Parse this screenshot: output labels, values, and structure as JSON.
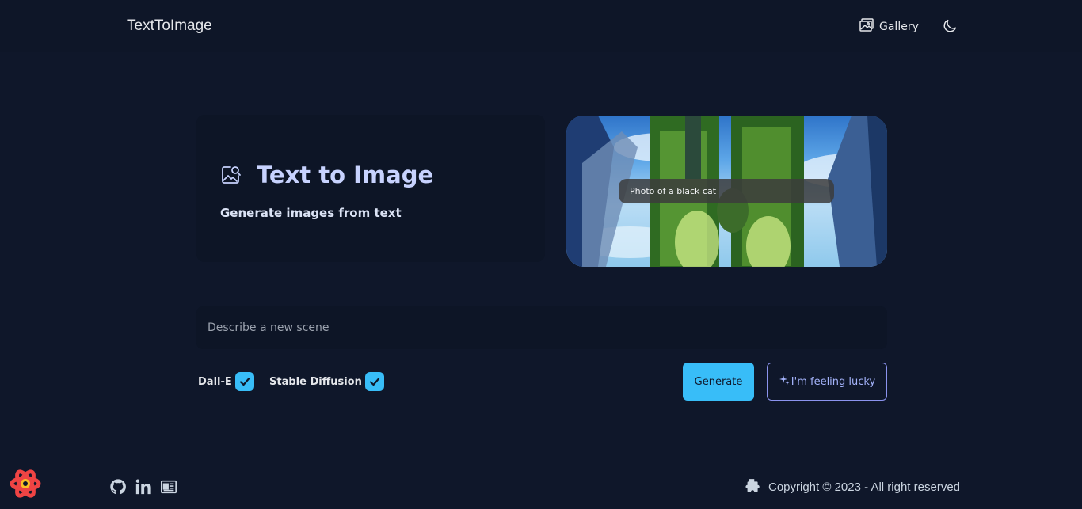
{
  "header": {
    "brand": "TextToImage",
    "gallery_label": "Gallery",
    "icons": [
      "gallery-icon",
      "moon-icon"
    ]
  },
  "hero": {
    "title": "Text to Image",
    "subtitle": "Generate images from text",
    "icon": "image-search-icon"
  },
  "preview": {
    "prompt_overlay": "Photo of a black cat"
  },
  "form": {
    "placeholder": "Describe a new scene",
    "value": "",
    "models": [
      {
        "label": "Dall-E",
        "checked": true
      },
      {
        "label": "Stable Diffusion",
        "checked": true
      }
    ],
    "generate_label": "Generate",
    "lucky_label": "I'm feeling lucky"
  },
  "footer": {
    "copyright": "Copyright © 2023 - All right reserved",
    "icons": [
      "react-logo-icon",
      "github-icon",
      "linkedin-icon",
      "newspaper-icon",
      "puzzle-icon"
    ]
  },
  "colors": {
    "background": "#0f172a",
    "accent": "#38bdf8",
    "secondary": "#8b93ee"
  }
}
